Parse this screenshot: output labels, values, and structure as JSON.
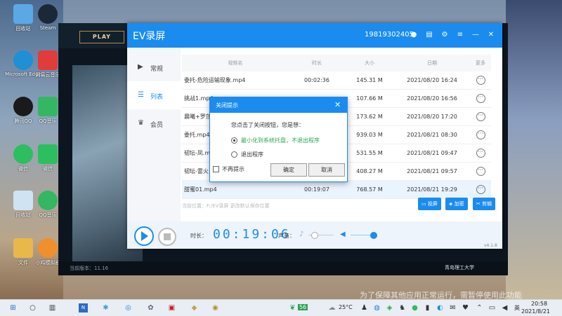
{
  "desktop": {
    "icons": [
      {
        "label": "回收站",
        "color": "#5aa9e6"
      },
      {
        "label": "Microsoft Edge",
        "color": "#1f8fd6"
      },
      {
        "label": "腾讯QQ",
        "color": "#1a1a1a"
      },
      {
        "label": "微信",
        "color": "#2dbe60"
      },
      {
        "label": "回收站",
        "color": "#cfe3f2"
      },
      {
        "label": "文件",
        "color": "#e8b84a"
      }
    ],
    "icons2": [
      {
        "label": "Steam",
        "color": "#1b2838"
      },
      {
        "label": "网易云音乐",
        "color": "#e03c3c"
      },
      {
        "label": "QQ音乐",
        "color": "#33b760"
      },
      {
        "label": "微信",
        "color": "#2dbe60"
      },
      {
        "label": "QQ音乐",
        "color": "#33b760"
      },
      {
        "label": "小鸡模拟器",
        "color": "#f0902a"
      }
    ],
    "caption": "为了保障其他应用正常运行，需暂停使用此功能"
  },
  "game": {
    "play_label": "PLAY",
    "bottom_left": "当前版本：11.16",
    "bottom_right": "青岛理工大学",
    "version_small": "V11.16"
  },
  "ev": {
    "title": "EV录屏",
    "phone": "19819302405",
    "sidebar": [
      {
        "icon": "▶",
        "label": "常规"
      },
      {
        "icon": "☰",
        "label": "列表"
      },
      {
        "icon": "♛",
        "label": "会员"
      }
    ],
    "columns": [
      "视频名",
      "时长",
      "大小",
      "日期",
      "更多"
    ],
    "rows": [
      {
        "name": "委托-危险运输现象.mp4",
        "duration": "00:02:36",
        "size": "145.31 M",
        "date": "2021/08/20 16:24"
      },
      {
        "name": "挑战1.mp4",
        "duration": "",
        "size": "107.66 M",
        "date": "2021/08/20 16:56"
      },
      {
        "name": "晨曦+罗莎",
        "duration": "",
        "size": "173.62 M",
        "date": "2021/08/20 17:20"
      },
      {
        "name": "委托.mp4",
        "duration": "",
        "size": "939.03 M",
        "date": "2021/08/21 08:30"
      },
      {
        "name": "韧坛-凤.m",
        "duration": "",
        "size": "531.55 M",
        "date": "2021/08/21 09:47"
      },
      {
        "name": "韧坛-雷火",
        "duration": "",
        "size": "408.27 M",
        "date": "2021/08/21 09:57"
      },
      {
        "name": "甜蜜01.mp4",
        "duration": "00:19:07",
        "size": "768.57 M",
        "date": "2021/08/21 19:29"
      }
    ],
    "more_glyph": "···",
    "path_text": "当前位置：F:/EV录屏    更改默认保存位置",
    "actions": [
      {
        "label": "投屏"
      },
      {
        "label": "加密"
      },
      {
        "label": "剪辑"
      }
    ],
    "time_label": "时长：",
    "timer": "00:19:06",
    "volume_label": "声音：",
    "version": "v4.1.8"
  },
  "dialog": {
    "title": "关闭提示",
    "question": "您点击了关闭按钮，您是想：",
    "option1": "最小化到系统托盘，不退出程序",
    "option2": "退出程序",
    "checkbox": "不再提示",
    "ok": "确定",
    "cancel": "取消"
  },
  "taskbar": {
    "weather_badge": "56",
    "temperature": "25°C",
    "language": "英",
    "time": "20:58",
    "date": "2021/8/21"
  }
}
